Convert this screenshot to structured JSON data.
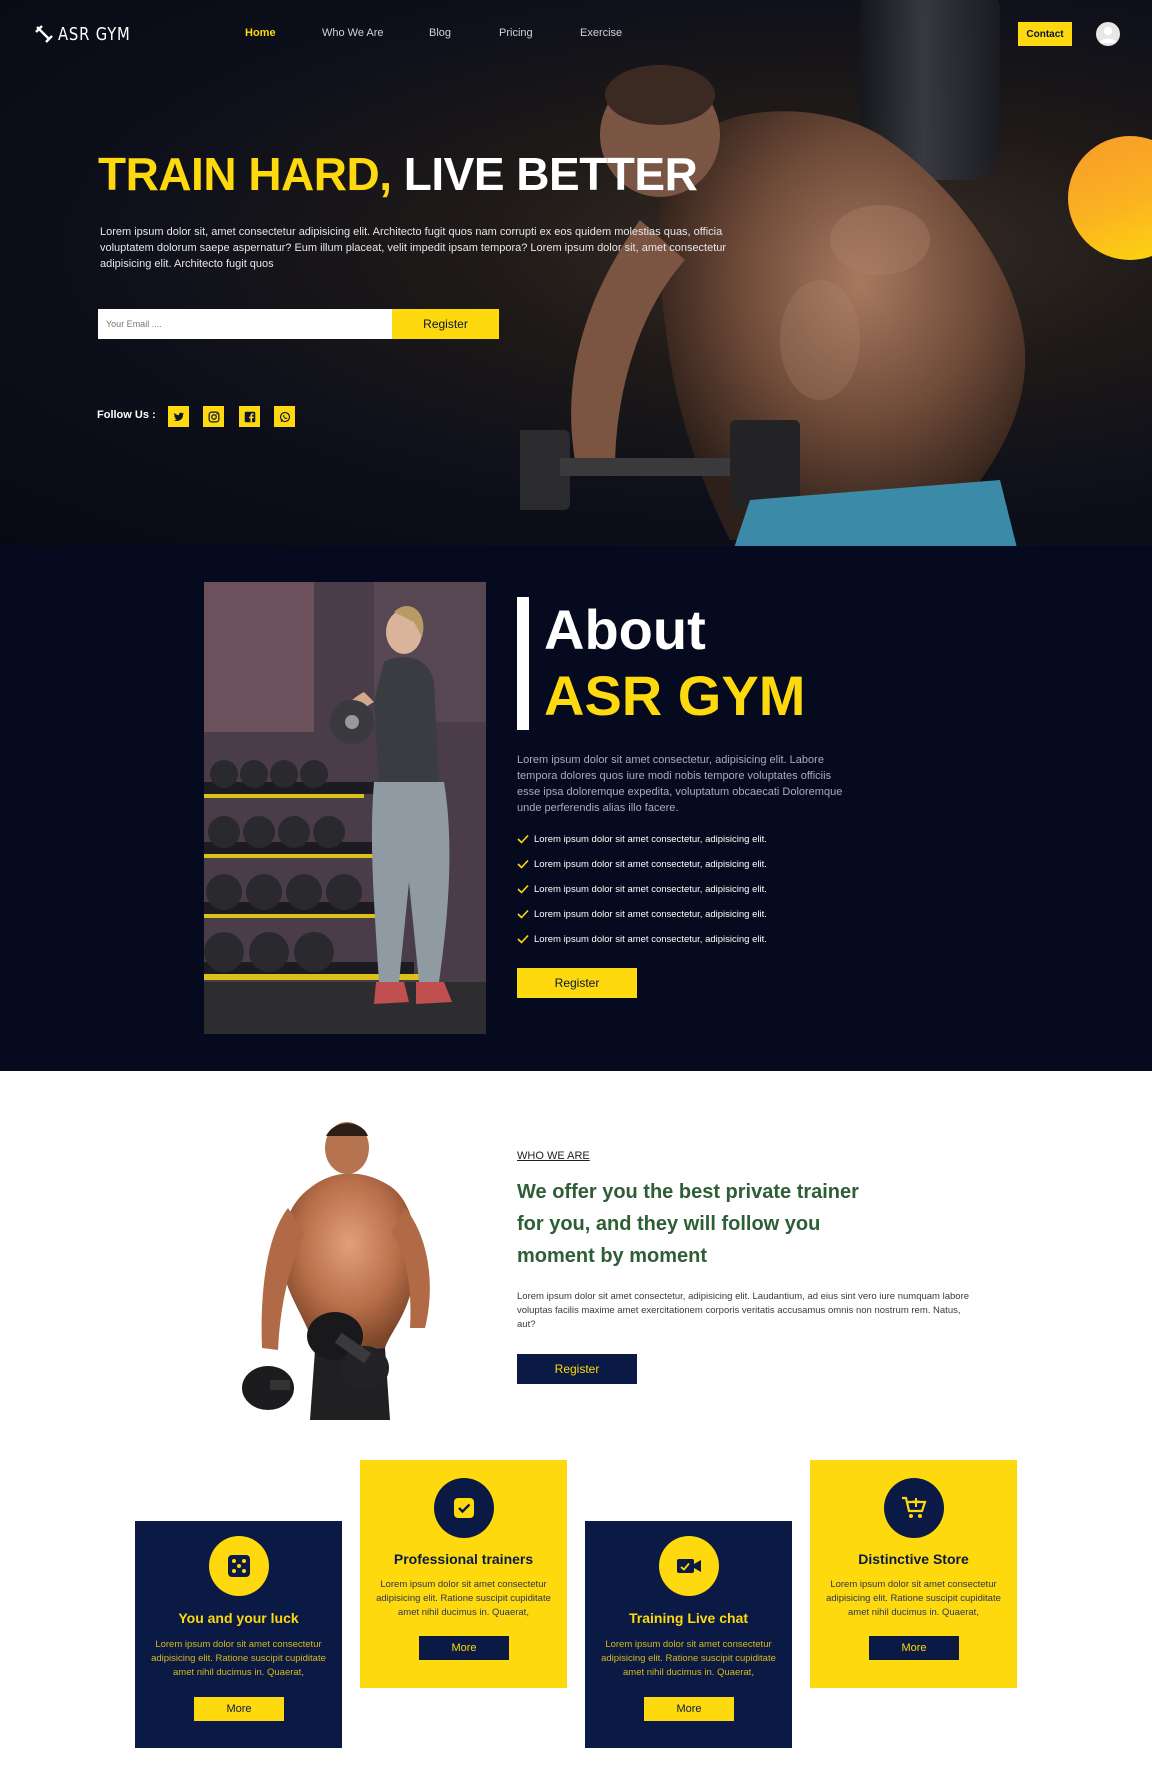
{
  "brand": {
    "name": "ASR GYM",
    "accent": "#fdd90e",
    "navy": "#0b1a44",
    "dark": "#060a1e"
  },
  "nav": {
    "links": [
      "Home",
      "Who We Are",
      "Blog",
      "Pricing",
      "Exercise"
    ],
    "active": "Home",
    "contact_label": "Contact"
  },
  "hero": {
    "title_highlight": "TRAIN HARD,",
    "title_rest": "LIVE BETTER",
    "text": "Lorem ipsum dolor sit, amet consectetur adipisicing elit. Architecto fugit quos nam corrupti ex eos quidem molestias quas, officia voluptatem dolorum saepe aspernatur? Eum illum placeat, velit impedit ipsam tempora? Lorem ipsum dolor sit, amet consectetur adipisicing elit. Architecto fugit quos",
    "email_placeholder": "Your Email ....",
    "register_label": "Register",
    "follow_label": "Follow Us :",
    "social_icons": [
      "twitter-icon",
      "instagram-icon",
      "facebook-icon",
      "whatsapp-icon"
    ]
  },
  "about": {
    "heading_line1": "About",
    "heading_line2": "ASR GYM",
    "text": "Lorem ipsum dolor sit amet consectetur, adipisicing elit. Labore tempora dolores quos iure modi nobis tempore voluptates officiis esse ipsa doloremque expedita, voluptatum obcaecati Doloremque unde perferendis alias illo facere.",
    "checklist": [
      "Lorem ipsum dolor sit amet consectetur, adipisicing elit.",
      "Lorem ipsum dolor sit amet consectetur, adipisicing elit.",
      "Lorem ipsum dolor sit amet consectetur, adipisicing elit.",
      "Lorem ipsum dolor sit amet consectetur, adipisicing elit.",
      "Lorem ipsum dolor sit amet consectetur, adipisicing elit."
    ],
    "register_label": "Register"
  },
  "who": {
    "eyebrow": "WHO WE ARE",
    "title": "We offer you the best private trainer for you, and they will follow you moment by moment",
    "text": "Lorem ipsum dolor sit amet consectetur, adipisicing elit. Laudantium, ad eius sint vero iure numquam labore voluptas facilis maxime amet exercitationem corporis veritatis accusamus omnis non nostrum rem. Natus, aut?",
    "register_label": "Register"
  },
  "cards": [
    {
      "title": "You and your luck",
      "icon": "dice-icon",
      "style": "dark",
      "text": "Lorem ipsum dolor sit amet consectetur adipisicing elit. Ratione suscipit cupiditate amet nihil ducimus in. Quaerat,",
      "button": "More"
    },
    {
      "title": "Professional trainers",
      "icon": "checkbox-icon",
      "style": "light",
      "text": "Lorem ipsum dolor sit amet consectetur adipisicing elit. Ratione suscipit cupiditate amet nihil ducimus in. Quaerat,",
      "button": "More"
    },
    {
      "title": "Training Live chat",
      "icon": "video-chat-icon",
      "style": "dark",
      "text": "Lorem ipsum dolor sit amet consectetur adipisicing elit. Ratione suscipit cupiditate amet nihil ducimus in. Quaerat,",
      "button": "More"
    },
    {
      "title": "Distinctive Store",
      "icon": "cart-icon",
      "style": "light",
      "text": "Lorem ipsum dolor sit amet consectetur adipisicing elit. Ratione suscipit cupiditate amet nihil ducimus in. Quaerat,",
      "button": "More"
    }
  ]
}
